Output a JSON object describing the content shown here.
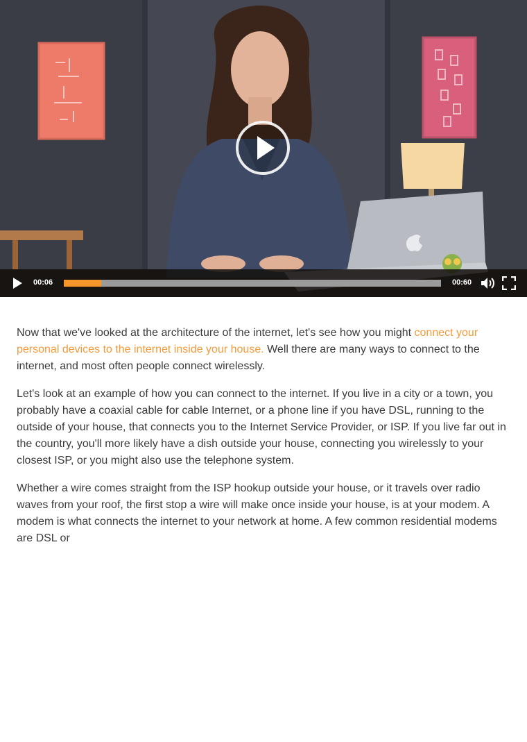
{
  "player": {
    "current_time": "00:06",
    "duration": "00:60",
    "progress_fraction": 0.1,
    "accent_color": "#f4962a",
    "icons": [
      "play-icon",
      "volume-icon",
      "fullscreen-icon"
    ]
  },
  "article": {
    "p1_before": "Now that we've looked at the architecture of the internet, let's see how you might ",
    "p1_link": "connect your personal devices to the internet inside your house.",
    "p1_after": " Well there are many ways to connect to the internet, and most often people connect wirelessly.",
    "p2": "Let's look at an example of how you can connect to the internet. If you live in a city or a town, you probably have a coaxial cable for cable Internet, or a phone line if you have DSL, running to the outside of your house, that connects you to the Internet Service Provider, or ISP. If you live far out in the country, you'll more likely have a dish outside your house, connecting you wirelessly to your closest ISP, or you might also use the telephone system.",
    "p3": "Whether a wire comes straight from the ISP hookup outside your house, or it travels over radio waves from your roof, the first stop a wire will make once inside your house, is at your modem. A modem is what connects the internet to your network at home. A few common residential modems are DSL or",
    "link_color": "#f39a3c"
  }
}
